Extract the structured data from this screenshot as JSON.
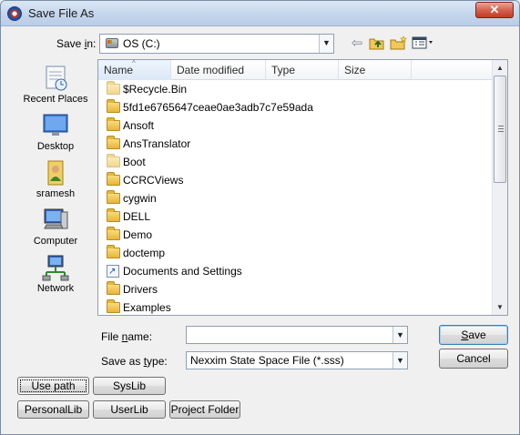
{
  "window": {
    "title": "Save File As",
    "close_label": "✕"
  },
  "save_in": {
    "label_prefix": "Save ",
    "label_accel": "i",
    "label_suffix": "n:",
    "value": "OS (C:)"
  },
  "toolbar": {
    "back_icon": "back-arrow-icon",
    "up_icon": "up-folder-icon",
    "new_folder_icon": "new-folder-icon",
    "views_icon": "views-menu-icon"
  },
  "places": [
    {
      "label": "Recent Places",
      "icon": "recent-places-icon"
    },
    {
      "label": "Desktop",
      "icon": "desktop-icon"
    },
    {
      "label": "sramesh",
      "icon": "user-folder-icon"
    },
    {
      "label": "Computer",
      "icon": "computer-icon"
    },
    {
      "label": "Network",
      "icon": "network-icon"
    }
  ],
  "columns": [
    "Name",
    "Date modified",
    "Type",
    "Size"
  ],
  "files": [
    {
      "name": "$Recycle.Bin",
      "icon": "folder-icon",
      "faint": true
    },
    {
      "name": "5fd1e6765647ceae0ae3adb7c7e59ada",
      "icon": "folder-icon"
    },
    {
      "name": "Ansoft",
      "icon": "folder-icon"
    },
    {
      "name": "AnsTranslator",
      "icon": "folder-icon"
    },
    {
      "name": "Boot",
      "icon": "folder-icon",
      "faint": true
    },
    {
      "name": "CCRCViews",
      "icon": "folder-icon"
    },
    {
      "name": "cygwin",
      "icon": "folder-icon"
    },
    {
      "name": "DELL",
      "icon": "folder-icon"
    },
    {
      "name": "Demo",
      "icon": "folder-icon"
    },
    {
      "name": "doctemp",
      "icon": "folder-icon"
    },
    {
      "name": "Documents and Settings",
      "icon": "shortcut-icon"
    },
    {
      "name": "Drivers",
      "icon": "folder-icon"
    },
    {
      "name": "Examples",
      "icon": "folder-icon"
    }
  ],
  "file_name": {
    "label_prefix": "File ",
    "label_accel": "n",
    "label_suffix": "ame:",
    "value": ""
  },
  "save_as_type": {
    "label_prefix": "Save as ",
    "label_accel": "t",
    "label_suffix": "ype:",
    "value": "Nexxim State Space File (*.sss)"
  },
  "buttons": {
    "save_accel": "S",
    "save_rest": "ave",
    "cancel": "Cancel",
    "use_path": "Use path",
    "syslib": "SysLib",
    "personallib": "PersonalLib",
    "userlib": "UserLib",
    "project_folder": "Project Folder"
  },
  "colors": {
    "title_bar": "#c4d6ec",
    "close_button": "#c23a22",
    "folder": "#e7b53b",
    "default_button_border": "#3c7fb1"
  }
}
